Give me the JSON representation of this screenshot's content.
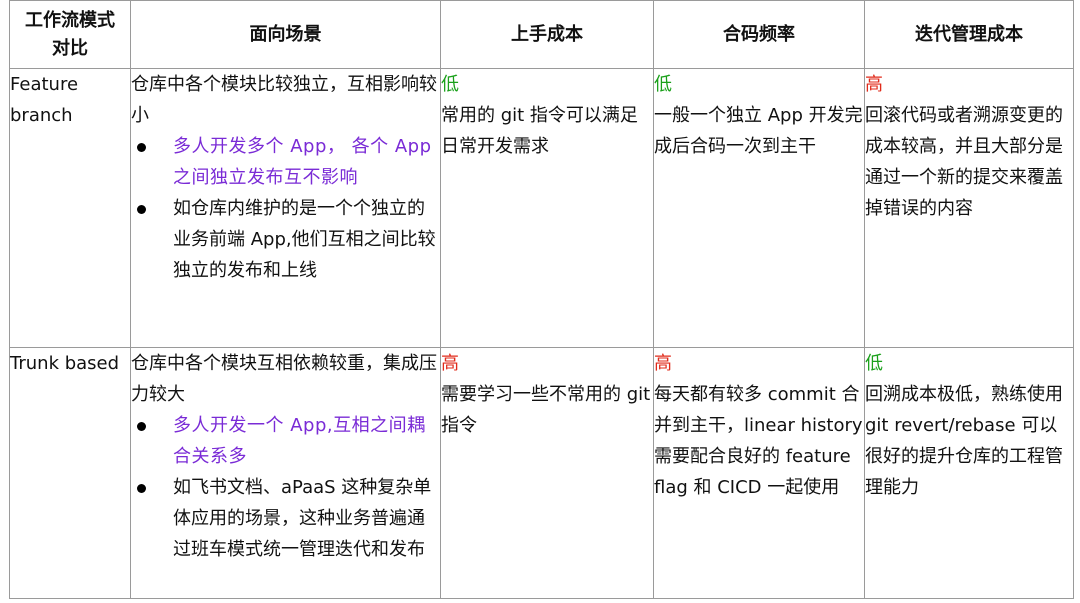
{
  "headers": [
    "工作流模式对比",
    "面向场景",
    "上手成本",
    "合码频率",
    "迭代管理成本"
  ],
  "rows": [
    {
      "name": "Feature branch",
      "scene": {
        "intro": "仓库中各个模块比较独立，互相影响较小",
        "bullets": [
          {
            "text": "多人开发多个 App， 各个 App 之间独立发布互不影响",
            "highlight": true
          },
          {
            "text": "如仓库内维护的是一个个独立的业务前端 App,他们互相之间比较独立的发布和上线",
            "highlight": false
          }
        ]
      },
      "onboarding": {
        "level": "低",
        "desc": "常用的 git 指令可以满足日常开发需求"
      },
      "merge_freq": {
        "level": "低",
        "desc": "一般一个独立 App 开发完成后合码一次到主干"
      },
      "iteration_cost": {
        "level": "高",
        "desc": "回滚代码或者溯源变更的成本较高，并且大部分是通过一个新的提交来覆盖掉错误的内容"
      }
    },
    {
      "name": "Trunk based",
      "scene": {
        "intro": "仓库中各个模块互相依赖较重，集成压力较大",
        "bullets": [
          {
            "text": "多人开发一个 App,互相之间耦合关系多",
            "highlight": true
          },
          {
            "text": "如飞书文档、aPaaS 这种复杂单体应用的场景，这种业务普遍通过班车模式统一管理迭代和发布",
            "highlight": false
          }
        ]
      },
      "onboarding": {
        "level": "高",
        "desc": "需要学习一些不常用的 git 指令"
      },
      "merge_freq": {
        "level": "高",
        "desc": "每天都有较多 commit 合并到主干，linear history 需要配合良好的 feature flag 和 CICD 一起使用"
      },
      "iteration_cost": {
        "level": "低",
        "desc": "回溯成本极低，熟练使用 git revert/rebase 可以很好的提升仓库的工程管理能力"
      }
    }
  ],
  "colors": {
    "low": "#1aa01a",
    "high": "#e02a1a",
    "highlight": "#7a2bd6",
    "border": "#9a9a9a"
  }
}
